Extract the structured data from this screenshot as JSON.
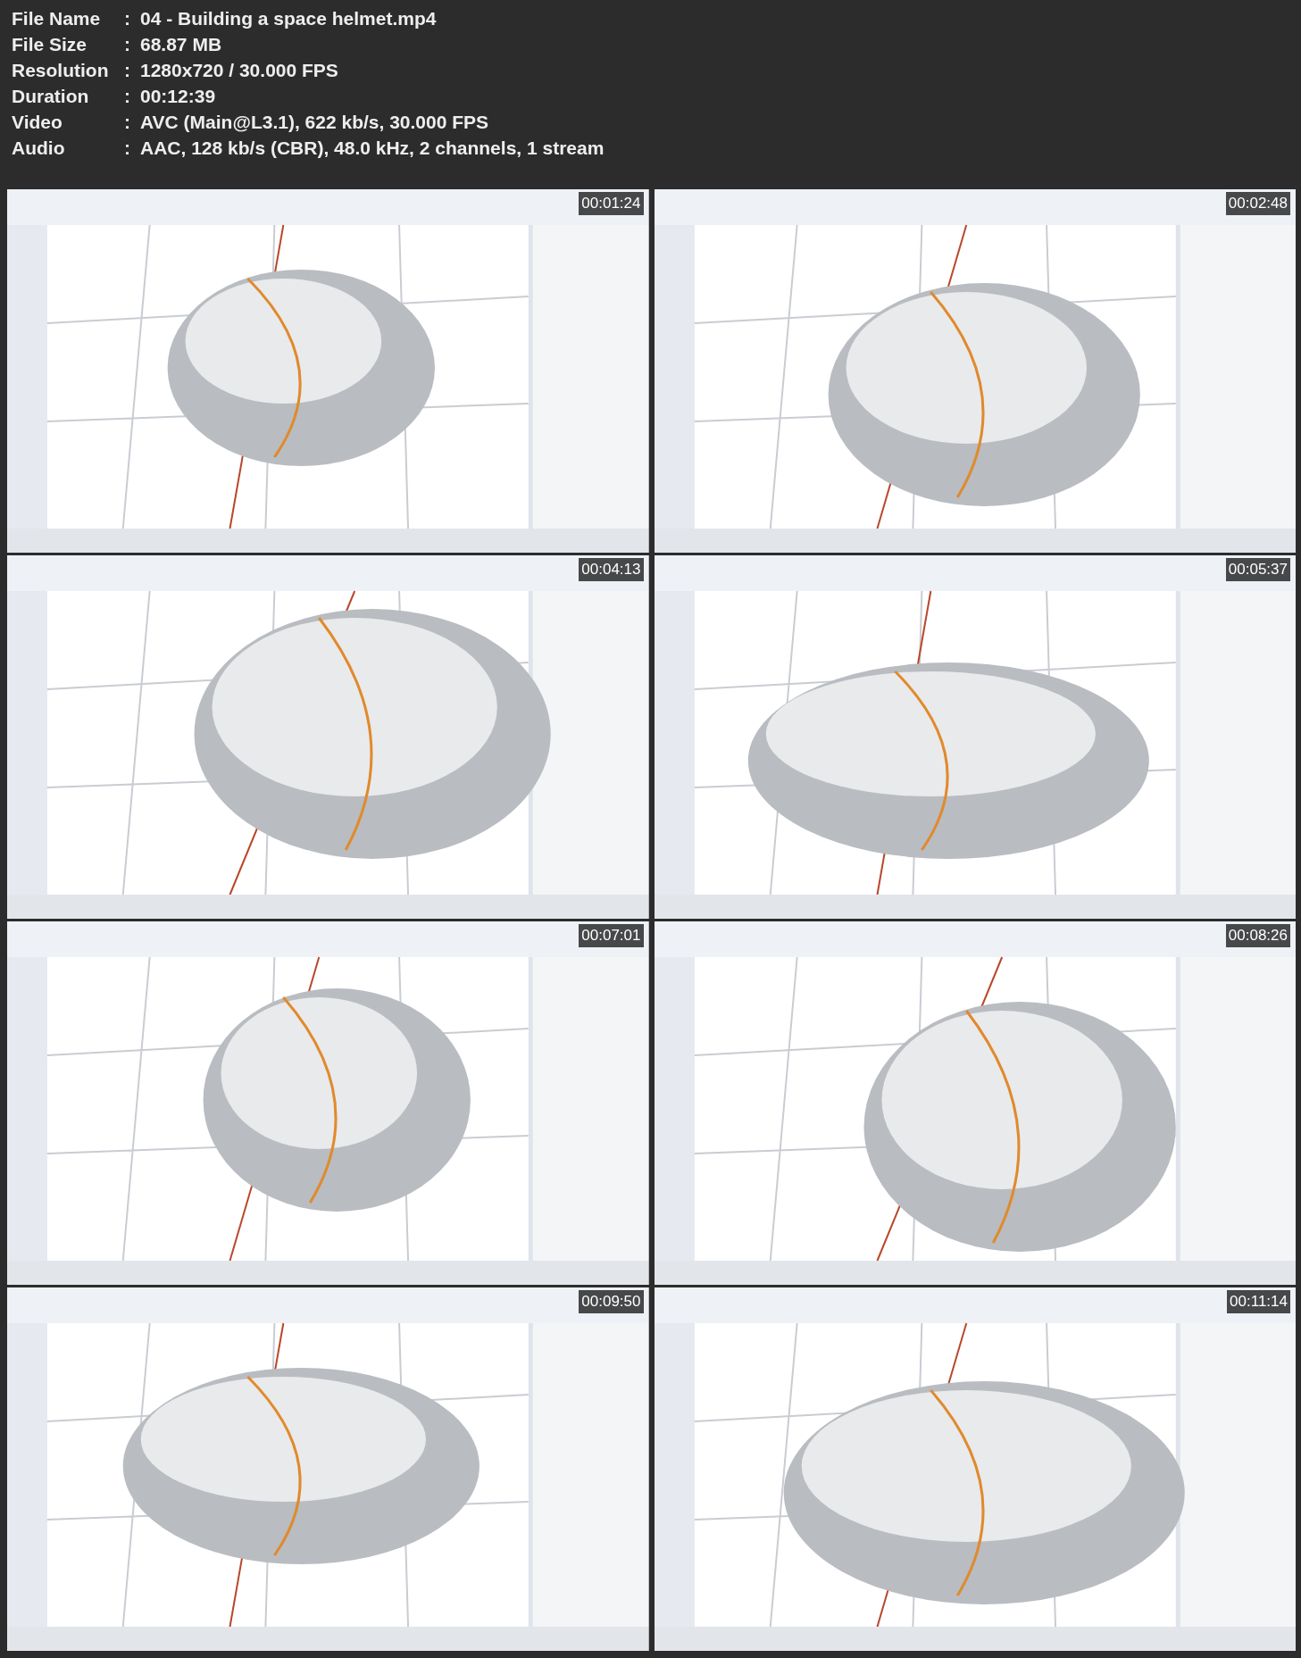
{
  "header": [
    {
      "label": "File Name",
      "separator": ":",
      "value": "04 - Building a space helmet.mp4"
    },
    {
      "label": "File Size",
      "separator": ":",
      "value": "68.87 MB"
    },
    {
      "label": "Resolution",
      "separator": ":",
      "value": "1280x720 / 30.000 FPS"
    },
    {
      "label": "Duration",
      "separator": ":",
      "value": "00:12:39"
    },
    {
      "label": "Video",
      "separator": ":",
      "value": "AVC (Main@L3.1), 622 kb/s, 30.000 FPS"
    },
    {
      "label": "Audio",
      "separator": ":",
      "value": "AAC, 128 kb/s (CBR), 48.0 kHz, 2 channels, 1 stream"
    }
  ],
  "frames": [
    {
      "kind": "picture",
      "timestamp": "00:01:24"
    },
    {
      "kind": "picture",
      "timestamp": "00:02:48"
    },
    {
      "kind": "picture",
      "timestamp": "00:04:13"
    },
    {
      "kind": "picture",
      "timestamp": "00:05:37"
    },
    {
      "kind": "picture",
      "timestamp": "00:07:01"
    },
    {
      "kind": "picture",
      "timestamp": "00:08:26"
    },
    {
      "kind": "picture",
      "timestamp": "00:09:50"
    },
    {
      "kind": "picture",
      "timestamp": "00:11:14"
    }
  ]
}
